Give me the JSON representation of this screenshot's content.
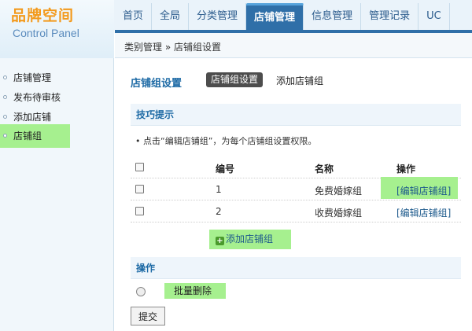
{
  "logo": {
    "title": "品牌空间",
    "subtitle": "Control Panel"
  },
  "nav": [
    {
      "label": "首页"
    },
    {
      "label": "全局"
    },
    {
      "label": "分类管理"
    },
    {
      "label": "店铺管理"
    },
    {
      "label": "信息管理"
    },
    {
      "label": "管理记录"
    },
    {
      "label": "UC"
    }
  ],
  "breadcrumb": "类别管理 » 店铺组设置",
  "sidebar": [
    {
      "label": "店铺管理"
    },
    {
      "label": "发布待审核"
    },
    {
      "label": "添加店铺"
    },
    {
      "label": "店铺组"
    }
  ],
  "main": {
    "title": "店铺组设置",
    "tab_current": "店铺组设置",
    "tab_add": "添加店铺组",
    "tips_title": "技巧提示",
    "tip": "点击“编辑店铺组”，为每个店铺组设置权限。",
    "table": {
      "headers": [
        "编号",
        "名称",
        "操作"
      ],
      "rows": [
        {
          "id": "1",
          "name": "免费婚嫁组",
          "op": "[编辑店铺组]"
        },
        {
          "id": "2",
          "name": "收费婚嫁组",
          "op": "[编辑店铺组]"
        }
      ]
    },
    "add_label": "添加店铺组",
    "ops_title": "操作",
    "batch_delete": "批量删除",
    "submit": "提交"
  },
  "colors": {
    "accent": "#2f6fa8",
    "highlight": "#a6f08f",
    "link": "#1d6aa5"
  }
}
